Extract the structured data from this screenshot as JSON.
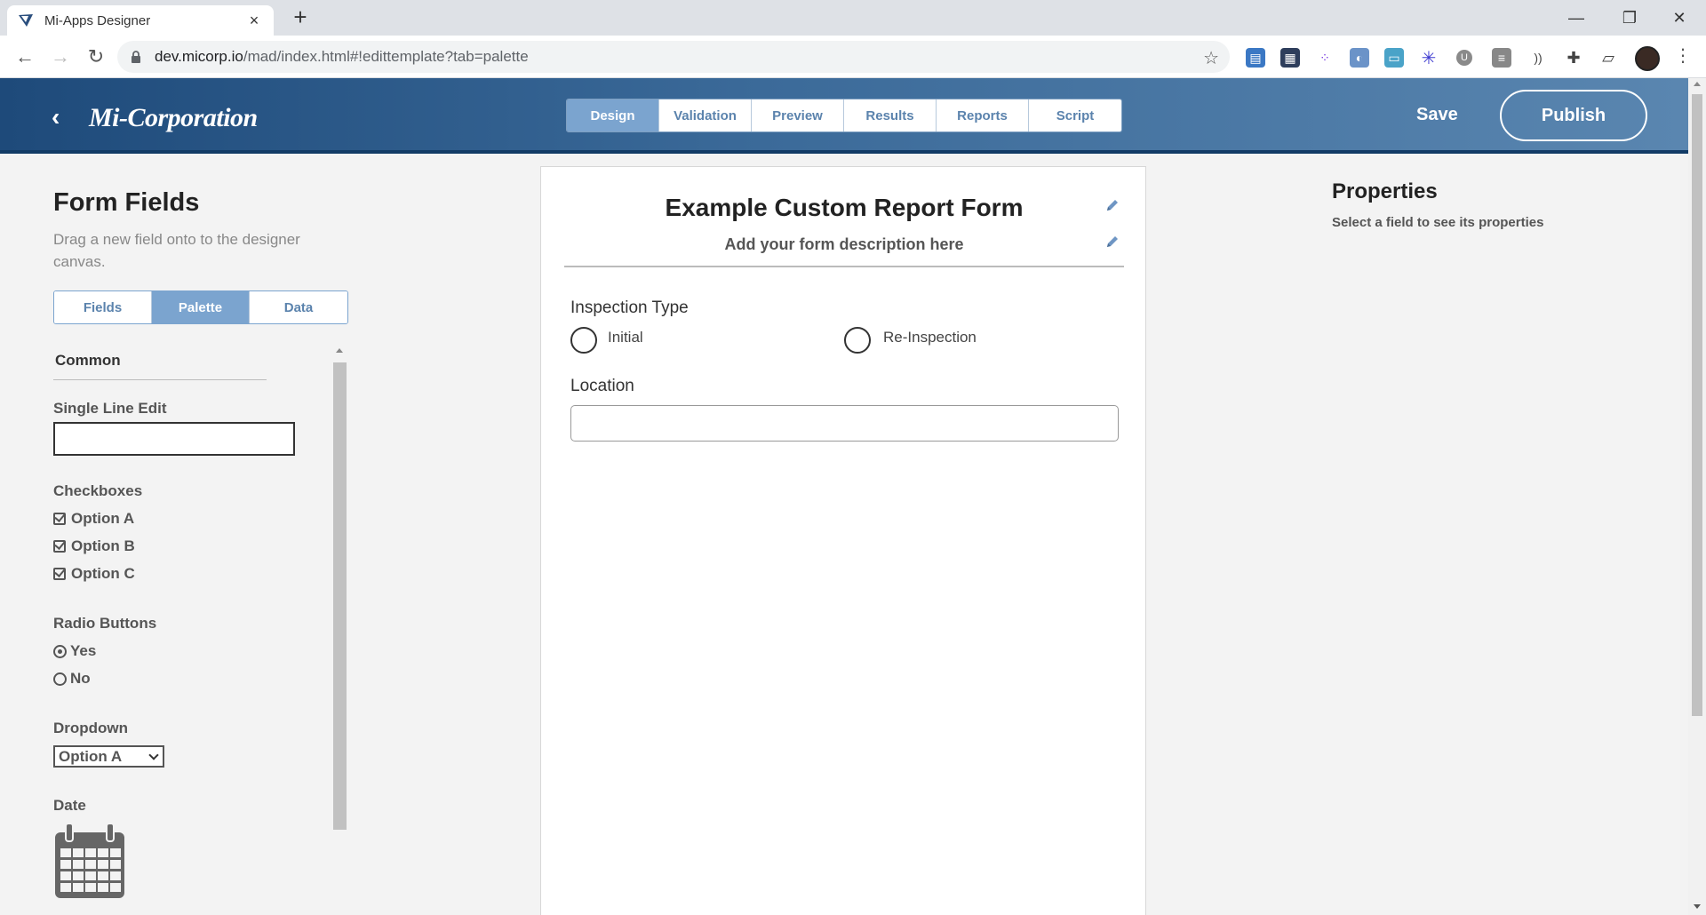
{
  "browser": {
    "tab_title": "Mi-Apps Designer",
    "tab_close": "×",
    "new_tab": "+",
    "url_host": "dev.micorp.io",
    "url_path": "/mad/index.html#!edittemplate?tab=palette",
    "window_controls": {
      "minimize": "—",
      "restore": "❐",
      "close": "✕"
    },
    "nav": {
      "back": "←",
      "forward": "→",
      "reload": "↻"
    },
    "bookmark_star": "☆",
    "menu": "⋮",
    "extension_icons": [
      "reader-icon",
      "clapperboard-icon",
      "dots-grid-icon",
      "globe-icon",
      "screen-icon",
      "asterisk-icon",
      "shield-icon",
      "bars-icon",
      "wave-icon",
      "puzzle-icon",
      "cast-icon"
    ]
  },
  "header": {
    "back_icon": "‹",
    "logo": "Mi-Corporation",
    "tabs": [
      {
        "label": "Design",
        "active": true
      },
      {
        "label": "Validation",
        "active": false
      },
      {
        "label": "Preview",
        "active": false
      },
      {
        "label": "Results",
        "active": false
      },
      {
        "label": "Reports",
        "active": false
      },
      {
        "label": "Script",
        "active": false
      }
    ],
    "save_label": "Save",
    "publish_label": "Publish",
    "colors": {
      "header_start": "#1e4a7a",
      "header_end": "#5a86b0",
      "accent": "#7ba4cf"
    }
  },
  "left": {
    "title": "Form Fields",
    "subtitle": "Drag a new field onto to the designer canvas.",
    "tabs": [
      {
        "label": "Fields",
        "active": false
      },
      {
        "label": "Palette",
        "active": true
      },
      {
        "label": "Data",
        "active": false
      }
    ],
    "palette": {
      "section": "Common",
      "single_line_label": "Single Line Edit",
      "checkboxes_label": "Checkboxes",
      "checkbox_options": [
        "Option A",
        "Option B",
        "Option C"
      ],
      "radio_label": "Radio Buttons",
      "radio_options": [
        {
          "label": "Yes",
          "selected": true
        },
        {
          "label": "No",
          "selected": false
        }
      ],
      "dropdown_label": "Dropdown",
      "dropdown_value": "Option A",
      "date_label": "Date"
    }
  },
  "canvas": {
    "form_title": "Example Custom Report Form",
    "form_description": "Add your form description here",
    "fields": [
      {
        "label": "Inspection Type",
        "type": "radio",
        "options": [
          "Initial",
          "Re-Inspection"
        ]
      },
      {
        "label": "Location",
        "type": "text",
        "value": ""
      }
    ]
  },
  "properties": {
    "title": "Properties",
    "hint": "Select a field to see its properties"
  }
}
